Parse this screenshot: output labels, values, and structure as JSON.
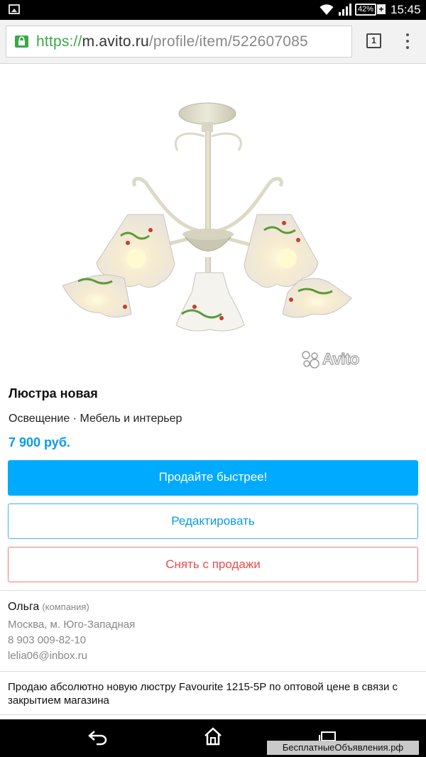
{
  "status_bar": {
    "battery_percent": "42%",
    "battery_charging_symbol": "+",
    "time": "15:45",
    "icons": [
      "image-notification-icon",
      "wifi-icon",
      "signal-icon",
      "battery-icon"
    ]
  },
  "browser": {
    "url_scheme": "https://",
    "url_host": "m.avito.ru",
    "url_path": "/profile/item/522607085",
    "tab_count": "1",
    "icons": [
      "lock-icon",
      "overflow-menu-icon"
    ]
  },
  "listing": {
    "image_alt": "chandelier-photo",
    "watermark": "Avito",
    "title": "Люстра новая",
    "category": "Освещение · Мебель и интерьер",
    "price": "7 900 руб."
  },
  "actions": {
    "sell_faster": "Продайте быстрее!",
    "edit": "Редактировать",
    "remove": "Снять с продажи"
  },
  "seller": {
    "name": "Ольга",
    "type": "(компания)",
    "location": "Москва, м. Юго-Западная",
    "phone": "8 903 009-82-10",
    "email": "lelia06@inbox.ru"
  },
  "description": "Продаю абсолютно новую люстру Favourite 1215-5P по оптовой цене в связи с закрытием магазина",
  "nav": {
    "icons": [
      "back-icon",
      "home-icon",
      "recent-apps-icon"
    ],
    "site_watermark": "БесплатныеОбъявления.рф"
  },
  "colors": {
    "accent": "#00aaff",
    "price": "#0a9be8",
    "danger": "#ee4d4d",
    "secure": "#3aa845"
  }
}
